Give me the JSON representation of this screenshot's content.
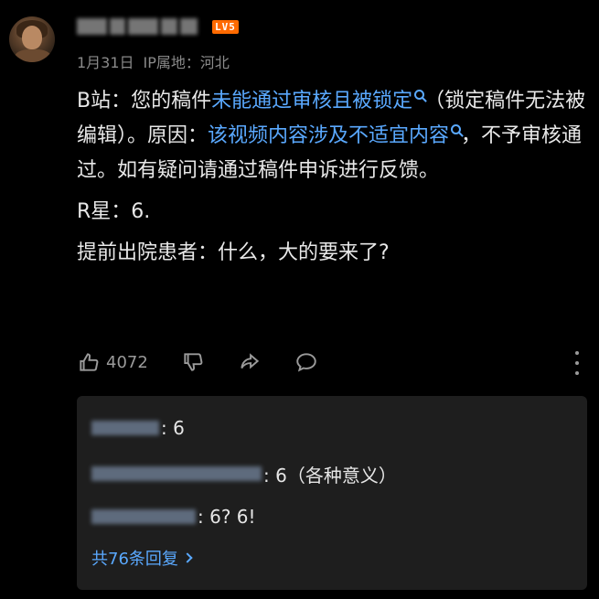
{
  "comment": {
    "level_badge": "LV5",
    "date": "1月31日",
    "ip_location": "IP属地：河北",
    "body": {
      "p1_prefix": "B站：您的稿件",
      "p1_link1": "未能通过审核且被锁定",
      "p1_mid": "（锁定稿件无法被编辑）。原因：",
      "p1_link2": "该视频内容涉及不适宜内容",
      "p1_suffix": "，不予审核通过。如有疑问请通过稿件申诉进行反馈。",
      "p2": "R星：6.",
      "p3": "提前出院患者：什么，大的要来了?"
    },
    "like_count": "4072"
  },
  "replies": {
    "items": [
      {
        "text": ": 6"
      },
      {
        "text": ": 6（各种意义）"
      },
      {
        "text": ": 6? 6!"
      }
    ],
    "more_label": "共76条回复"
  },
  "colors": {
    "background": "#000000",
    "link": "#5aa9ff",
    "level_badge": "#ff6a00",
    "reply_panel": "#1e1e1e",
    "muted": "#8a8a8a"
  },
  "icons": [
    "thumbs-up-icon",
    "thumbs-down-icon",
    "share-icon",
    "comment-icon",
    "more-vertical-icon",
    "search-icon",
    "chevron-right-icon"
  ]
}
